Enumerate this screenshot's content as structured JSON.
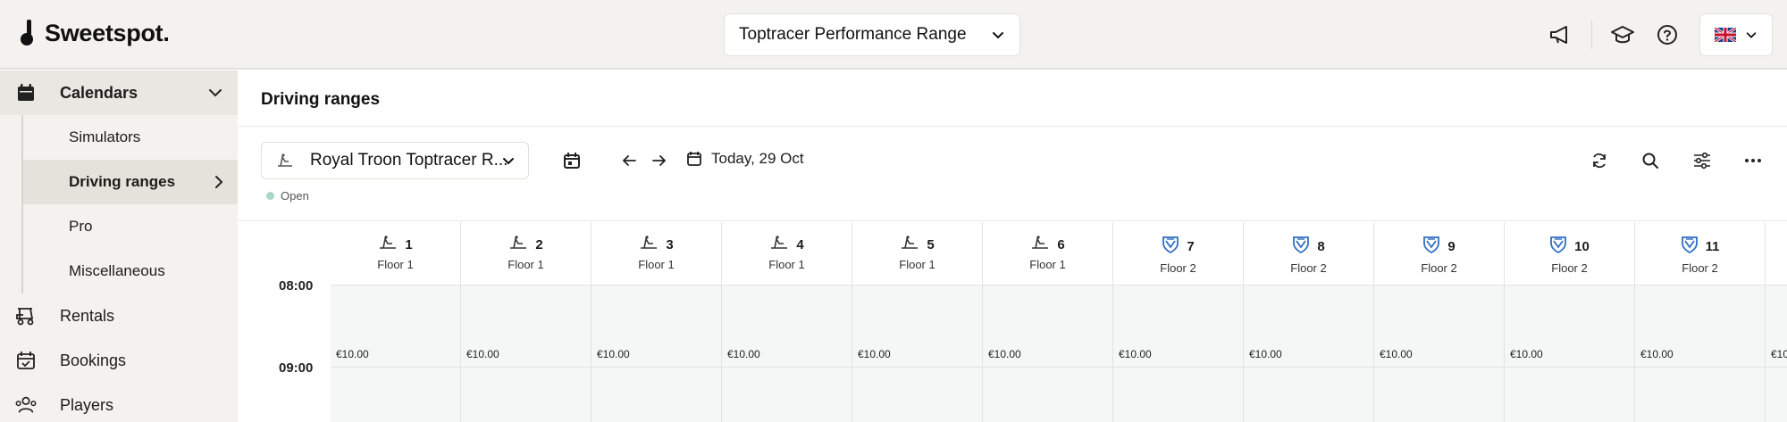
{
  "brand": {
    "name": "Sweetspot."
  },
  "header": {
    "venue": "Toptracer Performance Range",
    "language_flag": "🇬🇧"
  },
  "sidebar": {
    "items": [
      {
        "label": "Calendars",
        "icon": "calendar-icon",
        "expanded": true
      },
      {
        "label": "Rentals",
        "icon": "golf-cart-icon"
      },
      {
        "label": "Bookings",
        "icon": "calendar-check-icon"
      },
      {
        "label": "Players",
        "icon": "users-icon"
      }
    ],
    "calendar_subitems": [
      {
        "label": "Simulators"
      },
      {
        "label": "Driving ranges",
        "active": true
      },
      {
        "label": "Pro"
      },
      {
        "label": "Miscellaneous"
      }
    ]
  },
  "main": {
    "title": "Driving ranges",
    "range_select": "Royal Troon Toptracer R...",
    "date_label": "Today, 29 Oct",
    "status_label": "Open",
    "bays": [
      {
        "number": "1",
        "floor": "Floor 1",
        "icon": "golfer-mat-icon"
      },
      {
        "number": "2",
        "floor": "Floor 1",
        "icon": "golfer-mat-icon"
      },
      {
        "number": "3",
        "floor": "Floor 1",
        "icon": "golfer-mat-icon"
      },
      {
        "number": "4",
        "floor": "Floor 1",
        "icon": "golfer-mat-icon"
      },
      {
        "number": "5",
        "floor": "Floor 1",
        "icon": "golfer-mat-icon"
      },
      {
        "number": "6",
        "floor": "Floor 1",
        "icon": "golfer-mat-icon"
      },
      {
        "number": "7",
        "floor": "Floor 2",
        "icon": "toptracer-shield-icon"
      },
      {
        "number": "8",
        "floor": "Floor 2",
        "icon": "toptracer-shield-icon"
      },
      {
        "number": "9",
        "floor": "Floor 2",
        "icon": "toptracer-shield-icon"
      },
      {
        "number": "10",
        "floor": "Floor 2",
        "icon": "toptracer-shield-icon"
      },
      {
        "number": "11",
        "floor": "Floor 2",
        "icon": "toptracer-shield-icon"
      }
    ],
    "times": [
      "08:00",
      "09:00"
    ],
    "slot_price": "€10.00"
  },
  "colors": {
    "sidebar_bg": "#f3f2ee",
    "active_bg": "#e3e2db",
    "slot_bg": "#f4f7f5",
    "open_dot": "#a9d6c7",
    "shield_blue": "#2f6fc0"
  }
}
